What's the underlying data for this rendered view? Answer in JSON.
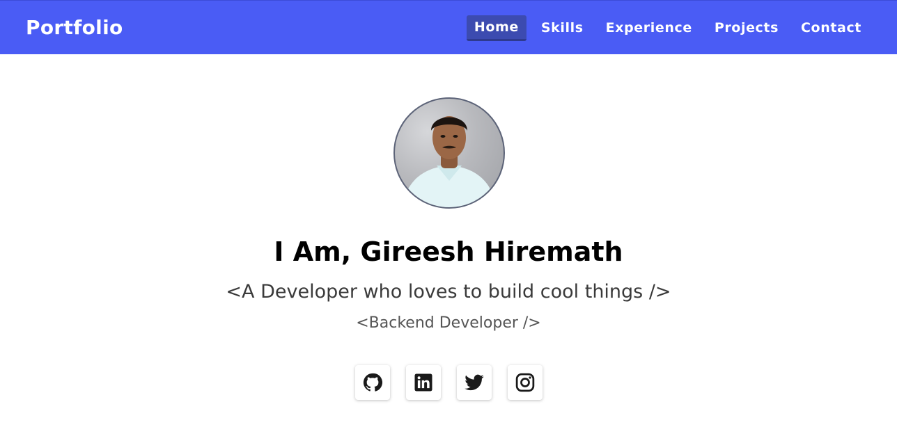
{
  "brand": "Portfolio",
  "nav": {
    "items": [
      {
        "label": "Home",
        "active": true
      },
      {
        "label": "Skills"
      },
      {
        "label": "Experience"
      },
      {
        "label": "Projects"
      },
      {
        "label": "Contact"
      }
    ]
  },
  "hero": {
    "headline": "I Am, Gireesh Hiremath",
    "tagline": "<A Developer who loves to build cool things />",
    "role": "<Backend Developer />"
  },
  "socials": [
    {
      "icon": "github-icon"
    },
    {
      "icon": "linkedin-icon"
    },
    {
      "icon": "twitter-icon"
    },
    {
      "icon": "instagram-icon"
    }
  ],
  "colors": {
    "navbar": "#4a5cf5",
    "nav_active": "#3c4bb0",
    "text": "#000000",
    "icon": "#1a1a1a"
  }
}
